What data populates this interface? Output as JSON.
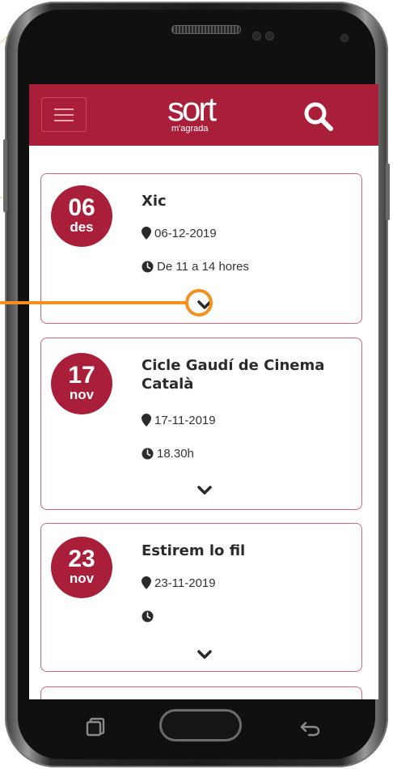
{
  "app": {
    "brand": "sort",
    "tagline": "m'agrada",
    "accent_color": "#a91f3a",
    "menu_icon": "hamburger-menu-icon",
    "search_icon": "search-icon"
  },
  "events": [
    {
      "day": "06",
      "month": "des",
      "title": "Xic",
      "date": "06-12-2019",
      "time": "De 11 a 14 hores",
      "expand_icon": "chevron-down-icon"
    },
    {
      "day": "17",
      "month": "nov",
      "title": "Cicle Gaudí de Cinema Català",
      "date": "17-11-2019",
      "time": "18.30h",
      "expand_icon": "chevron-down-icon"
    },
    {
      "day": "23",
      "month": "nov",
      "title": "Estirem lo fil",
      "date": "23-11-2019",
      "time": "",
      "expand_icon": "chevron-down-icon"
    }
  ],
  "callout_color": "#f5901e"
}
